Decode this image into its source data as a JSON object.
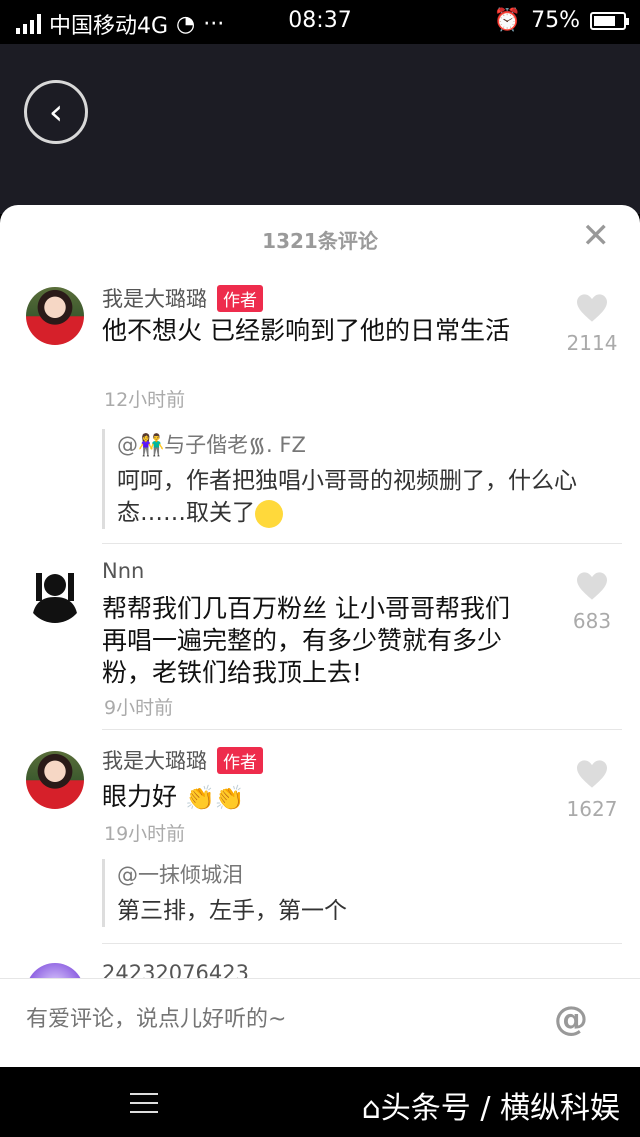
{
  "status_bar": {
    "carrier": "中国移动4G",
    "time": "08:37",
    "battery": "75%",
    "battery_level": 0.75
  },
  "sheet": {
    "title": "1321条评论",
    "close_icon": "close-icon"
  },
  "comments": [
    {
      "author": "我是大璐璐",
      "badge": "作者",
      "text": "他不想火 已经影响到了他的日常生活",
      "time": "12小时前",
      "likes": "2114",
      "reply": {
        "name": "@👫与子偕老᯾. FZ",
        "text": "呵呵，作者把独唱小哥哥的视频删了，什么心态……取关了"
      }
    },
    {
      "author": "Nnn",
      "text": "帮帮我们几百万粉丝  让小哥哥帮我们再唱一遍完整的，有多少赞就有多少粉，老铁们给我顶上去!",
      "time": "9小时前",
      "likes": "683"
    },
    {
      "author": "我是大璐璐",
      "badge": "作者",
      "text": "眼力好",
      "time": "19小时前",
      "likes": "1627",
      "reply": {
        "name": "@一抹倾城泪",
        "text": "第三排，左手，第一个"
      }
    },
    {
      "author": "24232076423"
    }
  ],
  "input": {
    "placeholder": "有爱评论，说点儿好听的~",
    "at_symbol": "@"
  },
  "nav": {
    "watermark": "⌂头条号 / 横纵科娱"
  }
}
